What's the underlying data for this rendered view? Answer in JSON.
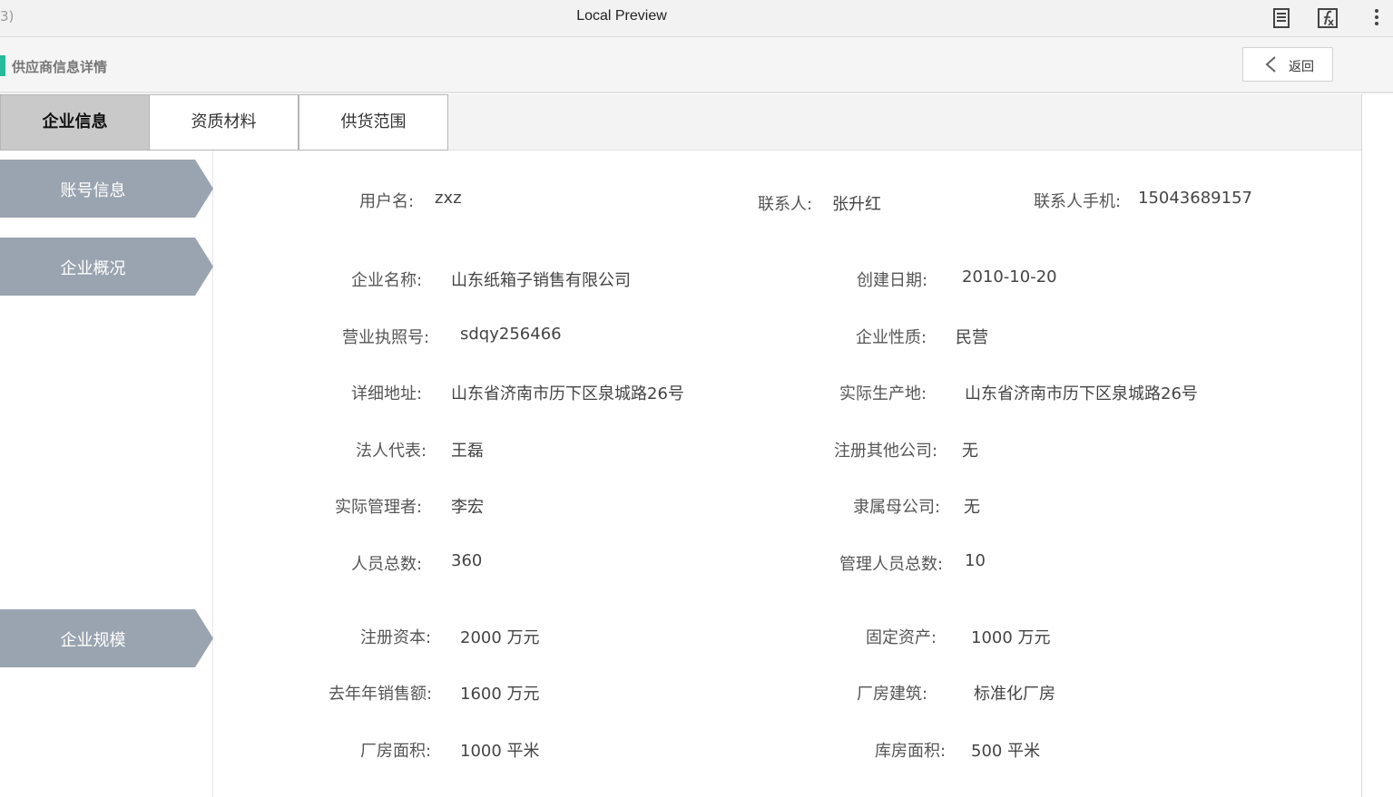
{
  "window": {
    "left_fragment": "3)",
    "title": "Local Preview",
    "icons": [
      "reader-icon",
      "fx-icon",
      "more-vertical-icon"
    ]
  },
  "header": {
    "title": "供应商信息详情",
    "back_label": "返回",
    "accent_color": "#27b99a"
  },
  "tabs": [
    {
      "label": "企业信息",
      "active": true
    },
    {
      "label": "资质材料",
      "active": false
    },
    {
      "label": "供货范围",
      "active": false
    }
  ],
  "sections": {
    "account": "账号信息",
    "overview": "企业概况",
    "scale": "企业规模"
  },
  "account": {
    "username_label": "用户名:",
    "username": "zxz",
    "contact_label": "联系人:",
    "contact": "张升红",
    "phone_label": "联系人手机:",
    "phone": "15043689157"
  },
  "overview": {
    "name_label": "企业名称:",
    "name": "山东纸箱子销售有限公司",
    "date_label": "创建日期:",
    "date": "2010-10-20",
    "license_label": "营业执照号:",
    "license": "sdqy256466",
    "nature_label": "企业性质:",
    "nature": "民营",
    "address_label": "详细地址:",
    "address": "山东省济南市历下区泉城路26号",
    "prod_label": "实际生产地:",
    "prod": "山东省济南市历下区泉城路26号",
    "legal_label": "法人代表:",
    "legal": "王磊",
    "other_label": "注册其他公司:",
    "other": "无",
    "manager_label": "实际管理者:",
    "manager": "李宏",
    "parent_label": "隶属母公司:",
    "parent": "无",
    "staff_label": "人员总数:",
    "staff": "360",
    "mgmt_label": "管理人员总数:",
    "mgmt": "10"
  },
  "scale": {
    "capital_label": "注册资本:",
    "capital": "2000 万元",
    "assets_label": "固定资产:",
    "assets": "1000 万元",
    "sales_label": "去年年销售额:",
    "sales": "1600 万元",
    "building_label": "厂房建筑:",
    "building": "标准化厂房",
    "plant_label": "厂房面积:",
    "plant": "1000 平米",
    "store_label": "库房面积:",
    "store": "500 平米"
  }
}
